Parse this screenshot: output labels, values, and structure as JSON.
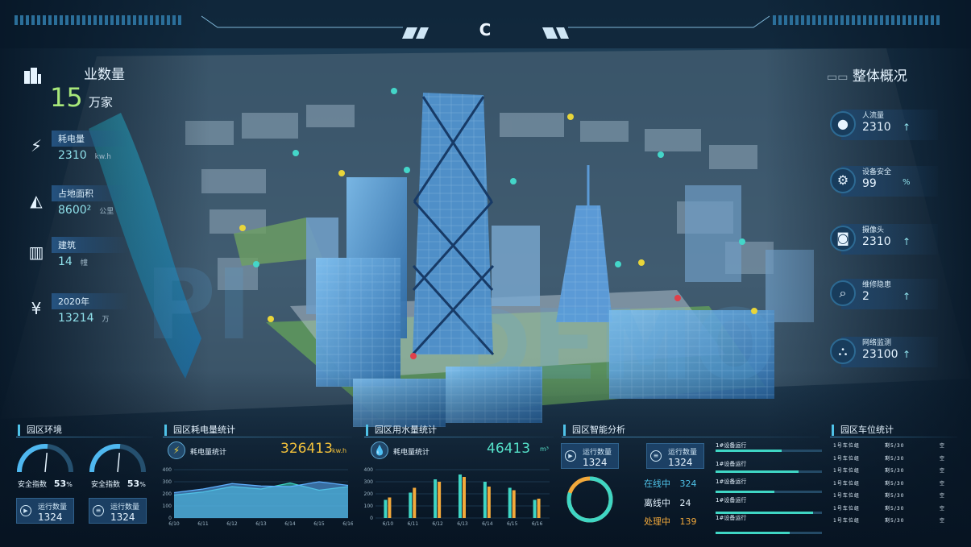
{
  "header": {
    "title": "C"
  },
  "left_stats": {
    "company_title": "业数量",
    "company_value": "15",
    "company_unit": "万家",
    "items": [
      {
        "icon": "lightning-icon",
        "label": "耗电量",
        "value": "2310",
        "unit": "kw.h"
      },
      {
        "icon": "area-chart-icon",
        "label": "占地面积",
        "value": "8600²",
        "unit": "公里"
      },
      {
        "icon": "building-icon",
        "label": "建筑",
        "value": "14",
        "unit": "幢"
      },
      {
        "icon": "yen-icon",
        "label": "2020年",
        "value": "13214",
        "unit": "万"
      }
    ]
  },
  "right_stats": {
    "title": "整体概况",
    "items": [
      {
        "icon": "person-icon",
        "label": "人流量",
        "value": "2310",
        "arrow": "↑"
      },
      {
        "icon": "gear-icon",
        "label": "设备安全",
        "value": "99",
        "unit": "%"
      },
      {
        "icon": "camera-icon",
        "label": "摄像头",
        "value": "2310",
        "arrow": "↑"
      },
      {
        "icon": "search-icon",
        "label": "维修隐患",
        "value": "2",
        "arrow": "↑"
      },
      {
        "icon": "network-icon",
        "label": "网络监测",
        "value": "23100",
        "arrow": "↑"
      }
    ]
  },
  "env_panel": {
    "title": "园区环境",
    "gauges": [
      {
        "label": "安全指数",
        "value": "53",
        "unit": "%",
        "fraction": 0.53
      },
      {
        "label": "安全指数",
        "value": "53",
        "unit": "%",
        "fraction": 0.53
      }
    ],
    "chips": [
      {
        "icon": "play-icon",
        "label": "运行数量",
        "value": "1324"
      },
      {
        "icon": "layers-icon",
        "label": "运行数量",
        "value": "1324"
      }
    ]
  },
  "power_panel": {
    "title": "园区耗电量统计",
    "stat_label": "耗电量统计",
    "stat_value": "326413",
    "stat_unit": "kw.h"
  },
  "water_panel": {
    "title": "园区用水量统计",
    "stat_label": "耗电量统计",
    "stat_value": "46413",
    "stat_unit": "m³"
  },
  "smart_panel": {
    "title": "园区智能分析",
    "chip1": {
      "label": "运行数量",
      "value": "1324"
    },
    "chip2": {
      "label": "运行数量",
      "value": "1324"
    },
    "online_label": "在线中",
    "online_value": "324",
    "offline_label": "离线中",
    "offline_value": "24",
    "processing_label": "处理中",
    "processing_value": "139",
    "donut_fraction": 0.8,
    "devices": [
      {
        "label": "1#设备运行",
        "fraction": 0.62
      },
      {
        "label": "1#设备运行",
        "fraction": 0.78
      },
      {
        "label": "1#设备运行",
        "fraction": 0.55
      },
      {
        "label": "1#设备运行",
        "fraction": 0.92
      },
      {
        "label": "1#设备运行",
        "fraction": 0.7
      }
    ]
  },
  "parking_panel": {
    "title": "园区车位统计",
    "rows": [
      [
        "1号车位组",
        "剩5/30",
        "空"
      ],
      [
        "1号车位组",
        "剩5/30",
        "空"
      ],
      [
        "1号车位组",
        "剩5/30",
        "空"
      ],
      [
        "1号车位组",
        "剩5/30",
        "空"
      ],
      [
        "1号车位组",
        "剩5/30",
        "空"
      ],
      [
        "1号车位组",
        "剩5/30",
        "空"
      ],
      [
        "1号车位组",
        "剩5/30",
        "空"
      ]
    ]
  },
  "chart_data": [
    {
      "type": "area",
      "x": [
        "6/10",
        "6/11",
        "6/12",
        "6/13",
        "6/14",
        "6/15",
        "6/16"
      ],
      "series": [
        {
          "values": [
            190,
            215,
            260,
            240,
            290,
            230,
            260
          ]
        },
        {
          "values": [
            210,
            240,
            285,
            265,
            260,
            300,
            270
          ]
        }
      ],
      "ylim": [
        0,
        400
      ],
      "yticks": [
        0,
        100,
        200,
        300,
        400
      ],
      "colors": [
        "#3fd6c4",
        "#5fb0ff"
      ]
    },
    {
      "type": "bar",
      "categories": [
        "6/10",
        "6/11",
        "6/12",
        "6/13",
        "6/14",
        "6/15",
        "6/16"
      ],
      "series": [
        {
          "values": [
            150,
            210,
            320,
            360,
            300,
            250,
            150
          ]
        },
        {
          "values": [
            170,
            250,
            300,
            340,
            260,
            230,
            160
          ]
        }
      ],
      "ylim": [
        0,
        400
      ],
      "yticks": [
        0,
        100,
        200,
        300,
        400
      ],
      "colors": [
        "#3fd6c4",
        "#f2a93b"
      ]
    }
  ],
  "colors": {
    "accent": "#4fc2e8",
    "teal": "#3fd6c4",
    "orange": "#f2a93b",
    "green": "#6cd18a"
  }
}
